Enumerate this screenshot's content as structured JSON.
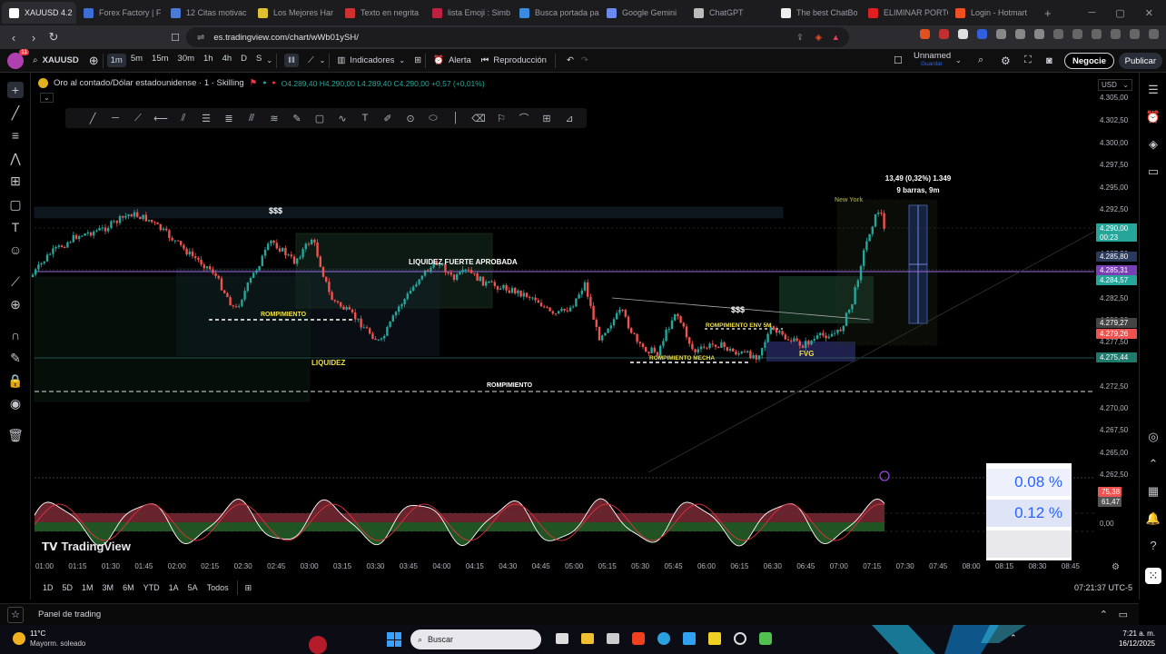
{
  "browser": {
    "tabs": [
      {
        "label": "XAUUSD 4.2",
        "active": true,
        "color": "#ffffff"
      },
      {
        "label": "Forex Factory | F",
        "color": "#3b6fd6"
      },
      {
        "label": "12 Citas motivac",
        "color": "#4a7bd4"
      },
      {
        "label": "Los Mejores Har",
        "color": "#e0c030"
      },
      {
        "label": "Texto en negrita",
        "color": "#d03030"
      },
      {
        "label": "lista Emoji : Simb",
        "color": "#c02040"
      },
      {
        "label": "Busca portada pa",
        "color": "#3a8ae0"
      },
      {
        "label": "Google Gemini",
        "color": "#6a8af0"
      },
      {
        "label": "ChatGPT",
        "color": "#bbbbbb"
      },
      {
        "label": "The best ChatBo",
        "color": "#eeeeee"
      },
      {
        "label": "ELIMINAR PORTO",
        "color": "#e02020"
      },
      {
        "label": "Login - Hotmart",
        "color": "#f05020"
      }
    ],
    "url": "es.tradingview.com/chart/wWb01ySH/"
  },
  "toolbar": {
    "symbol": "XAUUSD",
    "intervals": [
      "1m",
      "5m",
      "15m",
      "30m",
      "1h",
      "4h",
      "D",
      "S"
    ],
    "active_interval": "1m",
    "indicators": "Indicadores",
    "alert": "Alerta",
    "replay": "Reproducción",
    "layout_name": "Unnamed",
    "layout_sub": "Guardar",
    "negocie": "Negocie",
    "publicar": "Publicar",
    "avatar_badge": "11"
  },
  "legend": {
    "title": "Oro al contado/Dólar estadounidense · 1 · Skilling",
    "ohlc": "O4.289,40  H4.290,00  L4.289,40  C4.290,00  +0,57 (+0,01%)"
  },
  "currency": "USD",
  "price_axis": {
    "labels": [
      "4.305,00",
      "4.302,50",
      "4.300,00",
      "4.297,50",
      "4.295,00",
      "4.292,50",
      "4.287,50",
      "4.282,50",
      "4.280,00",
      "4.277,50",
      "4.272,50",
      "4.270,00",
      "4.267,50",
      "4.265,00",
      "4.262,50"
    ],
    "tags": [
      {
        "value": "4.290,00",
        "sub": "00:23",
        "color": "#26a69a"
      },
      {
        "value": "4.285,80",
        "color": "#2a3a5a"
      },
      {
        "value": "4.285,31",
        "color": "#7b3fb5"
      },
      {
        "value": "4.284,57",
        "color": "#26a69a"
      },
      {
        "value": "4.279,27",
        "color": "#444444"
      },
      {
        "value": "4.279,26",
        "color": "#ef5350"
      },
      {
        "value": "4.275,44",
        "color": "#1f7a6e"
      }
    ],
    "osc_tags": [
      {
        "value": "75,38",
        "color": "#ef5350"
      },
      {
        "value": "61,47",
        "color": "#555555"
      }
    ],
    "osc_zero": "0,00"
  },
  "annotations": {
    "sss_top": "$$$",
    "sss_mid": "$$$",
    "liquidez_fuerte": "LIQUIDEZ FUERTE APROBADA",
    "rompimiento_left": "ROMPIMIENTO",
    "liquidez": "LIQUIDEZ",
    "rompimiento_bottom": "ROMPIMIENTO",
    "rompimiento_mecha": "ROMPIMIENTO MECHA",
    "rompimiento_env": "ROMPIMIENTO ENV 5M",
    "fvg": "FVG",
    "new_york": "New York",
    "measure_1": "13,49 (0,32%) 1.349",
    "measure_2": "9 barras, 9m"
  },
  "percent_box": {
    "row1": "0.08 %",
    "row2": "0.12 %"
  },
  "watermark": "TradingView",
  "time_axis": [
    "01:00",
    "01:15",
    "01:30",
    "01:45",
    "02:00",
    "02:15",
    "02:30",
    "02:45",
    "03:00",
    "03:15",
    "03:30",
    "03:45",
    "04:00",
    "04:15",
    "04:30",
    "04:45",
    "05:00",
    "05:15",
    "05:30",
    "05:45",
    "06:00",
    "06:15",
    "06:30",
    "06:45",
    "07:00",
    "07:15",
    "07:30",
    "07:45",
    "08:00",
    "08:15",
    "08:30",
    "08:45"
  ],
  "ranges": [
    "1D",
    "5D",
    "1M",
    "3M",
    "6M",
    "YTD",
    "1A",
    "5A",
    "Todos"
  ],
  "clock": "07:21:37 UTC-5",
  "panel": "Panel de trading",
  "taskbar": {
    "weather_temp": "11°C",
    "weather_desc": "Mayorm. soleado",
    "search": "Buscar",
    "time": "7:21 a. m.",
    "date": "16/12/2025"
  },
  "colors": {
    "up": "#26a69a",
    "down": "#ef5350",
    "accent": "#2962ff"
  }
}
